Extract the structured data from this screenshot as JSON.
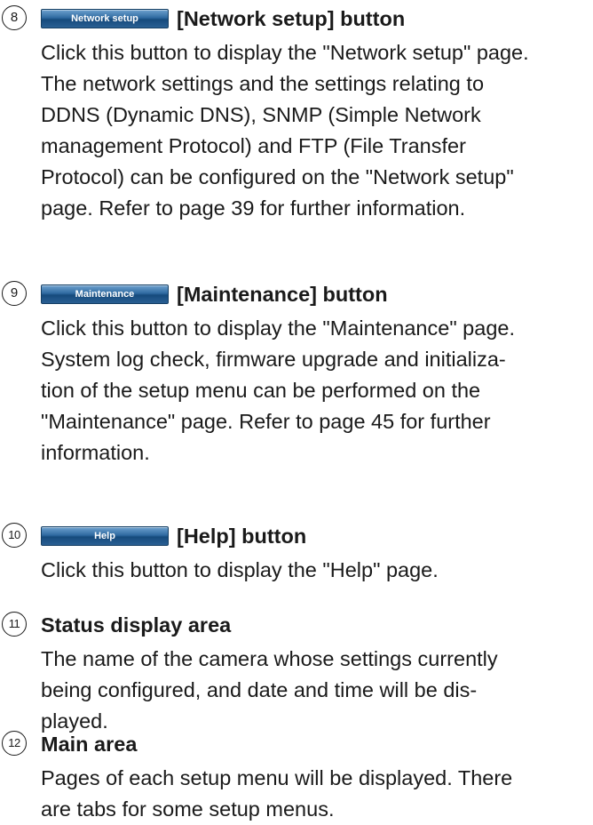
{
  "items": [
    {
      "number": "8",
      "button_label": "Network setup",
      "title": "[Network setup] button",
      "lines": [
        "Click this button to display the \"Network setup\" page.",
        "The network settings and the settings relating to",
        "DDNS (Dynamic DNS), SNMP (Simple Network",
        "management Protocol) and FTP (File Transfer",
        "Protocol) can be configured on the \"Network setup\"",
        "page. Refer to page 39 for further information."
      ]
    },
    {
      "number": "9",
      "button_label": "Maintenance",
      "title": "[Maintenance] button",
      "lines": [
        "Click this button to display the \"Maintenance\" page.",
        "System log check, firmware upgrade and initializa-",
        "tion of the setup menu can be performed on the",
        "\"Maintenance\" page. Refer to page 45 for further",
        "information."
      ]
    },
    {
      "number": "10",
      "button_label": "Help",
      "title": "[Help] button",
      "lines": [
        "Click this button to display the \"Help\" page."
      ]
    },
    {
      "number": "11",
      "title": "Status display area",
      "lines": [
        "The name of the camera whose settings currently",
        "being configured, and date and time will be dis-",
        "played."
      ]
    },
    {
      "number": "12",
      "title": "Main area",
      "lines": [
        "Pages of each setup menu will be displayed. There",
        "are tabs for some setup menus."
      ]
    }
  ]
}
